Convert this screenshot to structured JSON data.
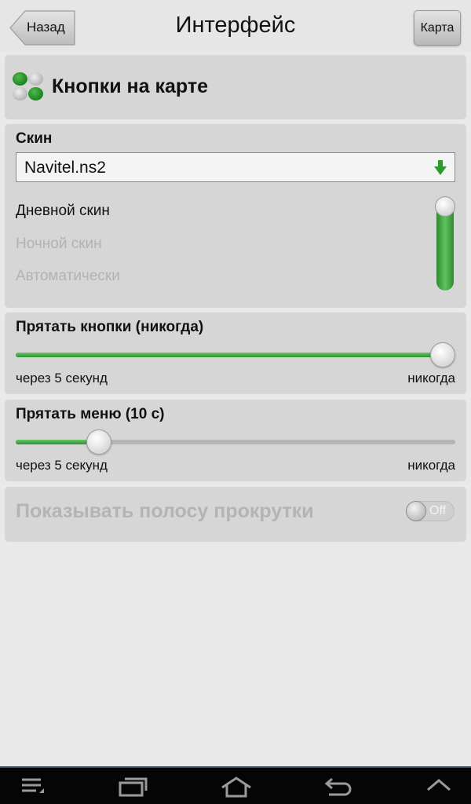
{
  "header": {
    "back_label": "Назад",
    "title": "Интерфейс",
    "map_label": "Карта"
  },
  "buttons_section": {
    "title": "Кнопки на карте"
  },
  "skin": {
    "label": "Скин",
    "selected": "Navitel.ns2",
    "options": [
      "Дневной скин",
      "Ночной скин",
      "Автоматически"
    ],
    "active_option": "Дневной скин"
  },
  "hide_buttons": {
    "label": "Прятать кнопки (никогда)",
    "min_label": "через 5 секунд",
    "max_label": "никогда",
    "value_fraction": 1.0
  },
  "hide_menu": {
    "label": "Прятать меню (10 с)",
    "min_label": "через 5 секунд",
    "max_label": "никогда",
    "value_fraction": 0.19
  },
  "scrollbar": {
    "label": "Показывать полосу прокрутки",
    "toggle_label": "Off",
    "enabled": false
  },
  "navbar": {
    "icons": [
      "menu-icon",
      "recent-apps-icon",
      "home-icon",
      "back-icon",
      "chevron-up-icon"
    ]
  },
  "colors": {
    "accent_green": "#2c922c",
    "panel_bg": "#d6d6d6",
    "page_bg": "#e9e9e9"
  }
}
